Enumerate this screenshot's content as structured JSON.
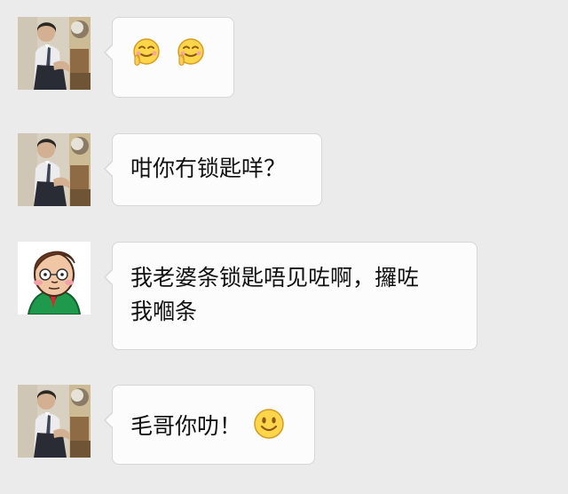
{
  "messages": [
    {
      "sender": "man-in-suit",
      "emoji": [
        "hehe-hand-over-mouth",
        "hehe-hand-over-mouth"
      ]
    },
    {
      "sender": "man-in-suit",
      "text": "咁你冇锁匙咩？"
    },
    {
      "sender": "cartoon-man",
      "text_lines": [
        "我老婆条锁匙唔见咗啊，攞咗",
        "我嗰条"
      ]
    },
    {
      "sender": "man-in-suit",
      "text": "毛哥你叻！",
      "emoji": "smile"
    }
  ],
  "colors": {
    "background": "#ebebeb",
    "bubble": "#fcfcfd",
    "bubble_border": "#d6d6d6",
    "emoji_yellow": "#ffd54a"
  }
}
